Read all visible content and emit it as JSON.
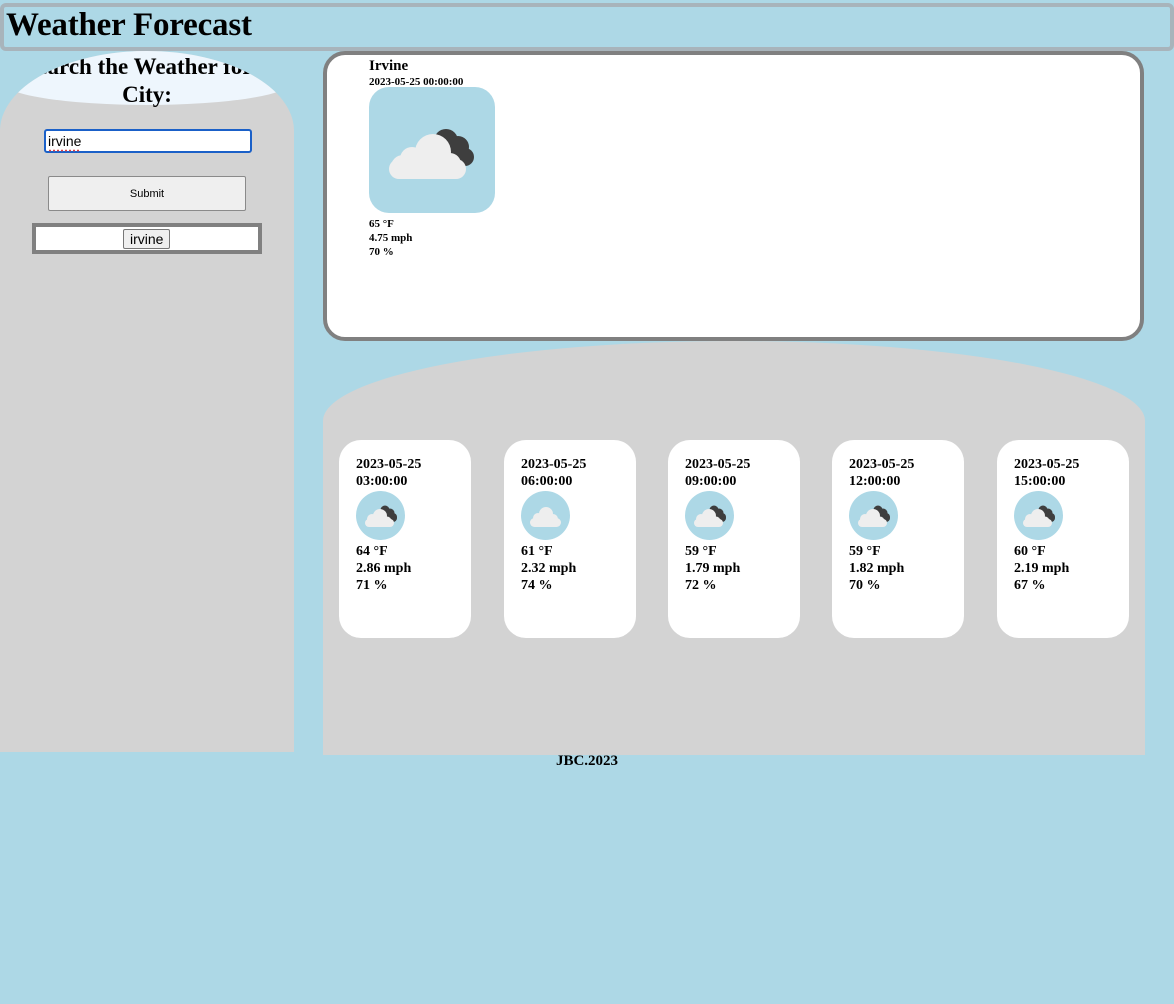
{
  "header": {
    "title": "Weather Forecast"
  },
  "sidebar": {
    "title": "Search the Weather for a City:",
    "search": {
      "value": "irvine",
      "placeholder": ""
    },
    "submit_label": "Submit",
    "history": [
      "irvine"
    ]
  },
  "current": {
    "city": "Irvine",
    "datetime": "2023-05-25 00:00:00",
    "icon": "cloudy-icon",
    "temp": "65 °F",
    "wind": "4.75 mph",
    "humidity": "70 %"
  },
  "forecast": [
    {
      "date": "2023-05-25",
      "time": "03:00:00",
      "icon": "cloudy-icon",
      "temp": "64 °F",
      "wind": "2.86 mph",
      "humidity": "71 %"
    },
    {
      "date": "2023-05-25",
      "time": "06:00:00",
      "icon": "cloud-icon",
      "temp": "61 °F",
      "wind": "2.32 mph",
      "humidity": "74 %"
    },
    {
      "date": "2023-05-25",
      "time": "09:00:00",
      "icon": "cloudy-icon",
      "temp": "59 °F",
      "wind": "1.79 mph",
      "humidity": "72 %"
    },
    {
      "date": "2023-05-25",
      "time": "12:00:00",
      "icon": "cloudy-icon",
      "temp": "59 °F",
      "wind": "1.82 mph",
      "humidity": "70 %"
    },
    {
      "date": "2023-05-25",
      "time": "15:00:00",
      "icon": "cloudy-icon",
      "temp": "60 °F",
      "wind": "2.19 mph",
      "humidity": "67 %"
    }
  ],
  "footer": {
    "text": "JBC.2023"
  },
  "colors": {
    "background": "#add8e6",
    "panel": "#d3d3d3",
    "card": "#ffffff",
    "border": "#808080"
  }
}
